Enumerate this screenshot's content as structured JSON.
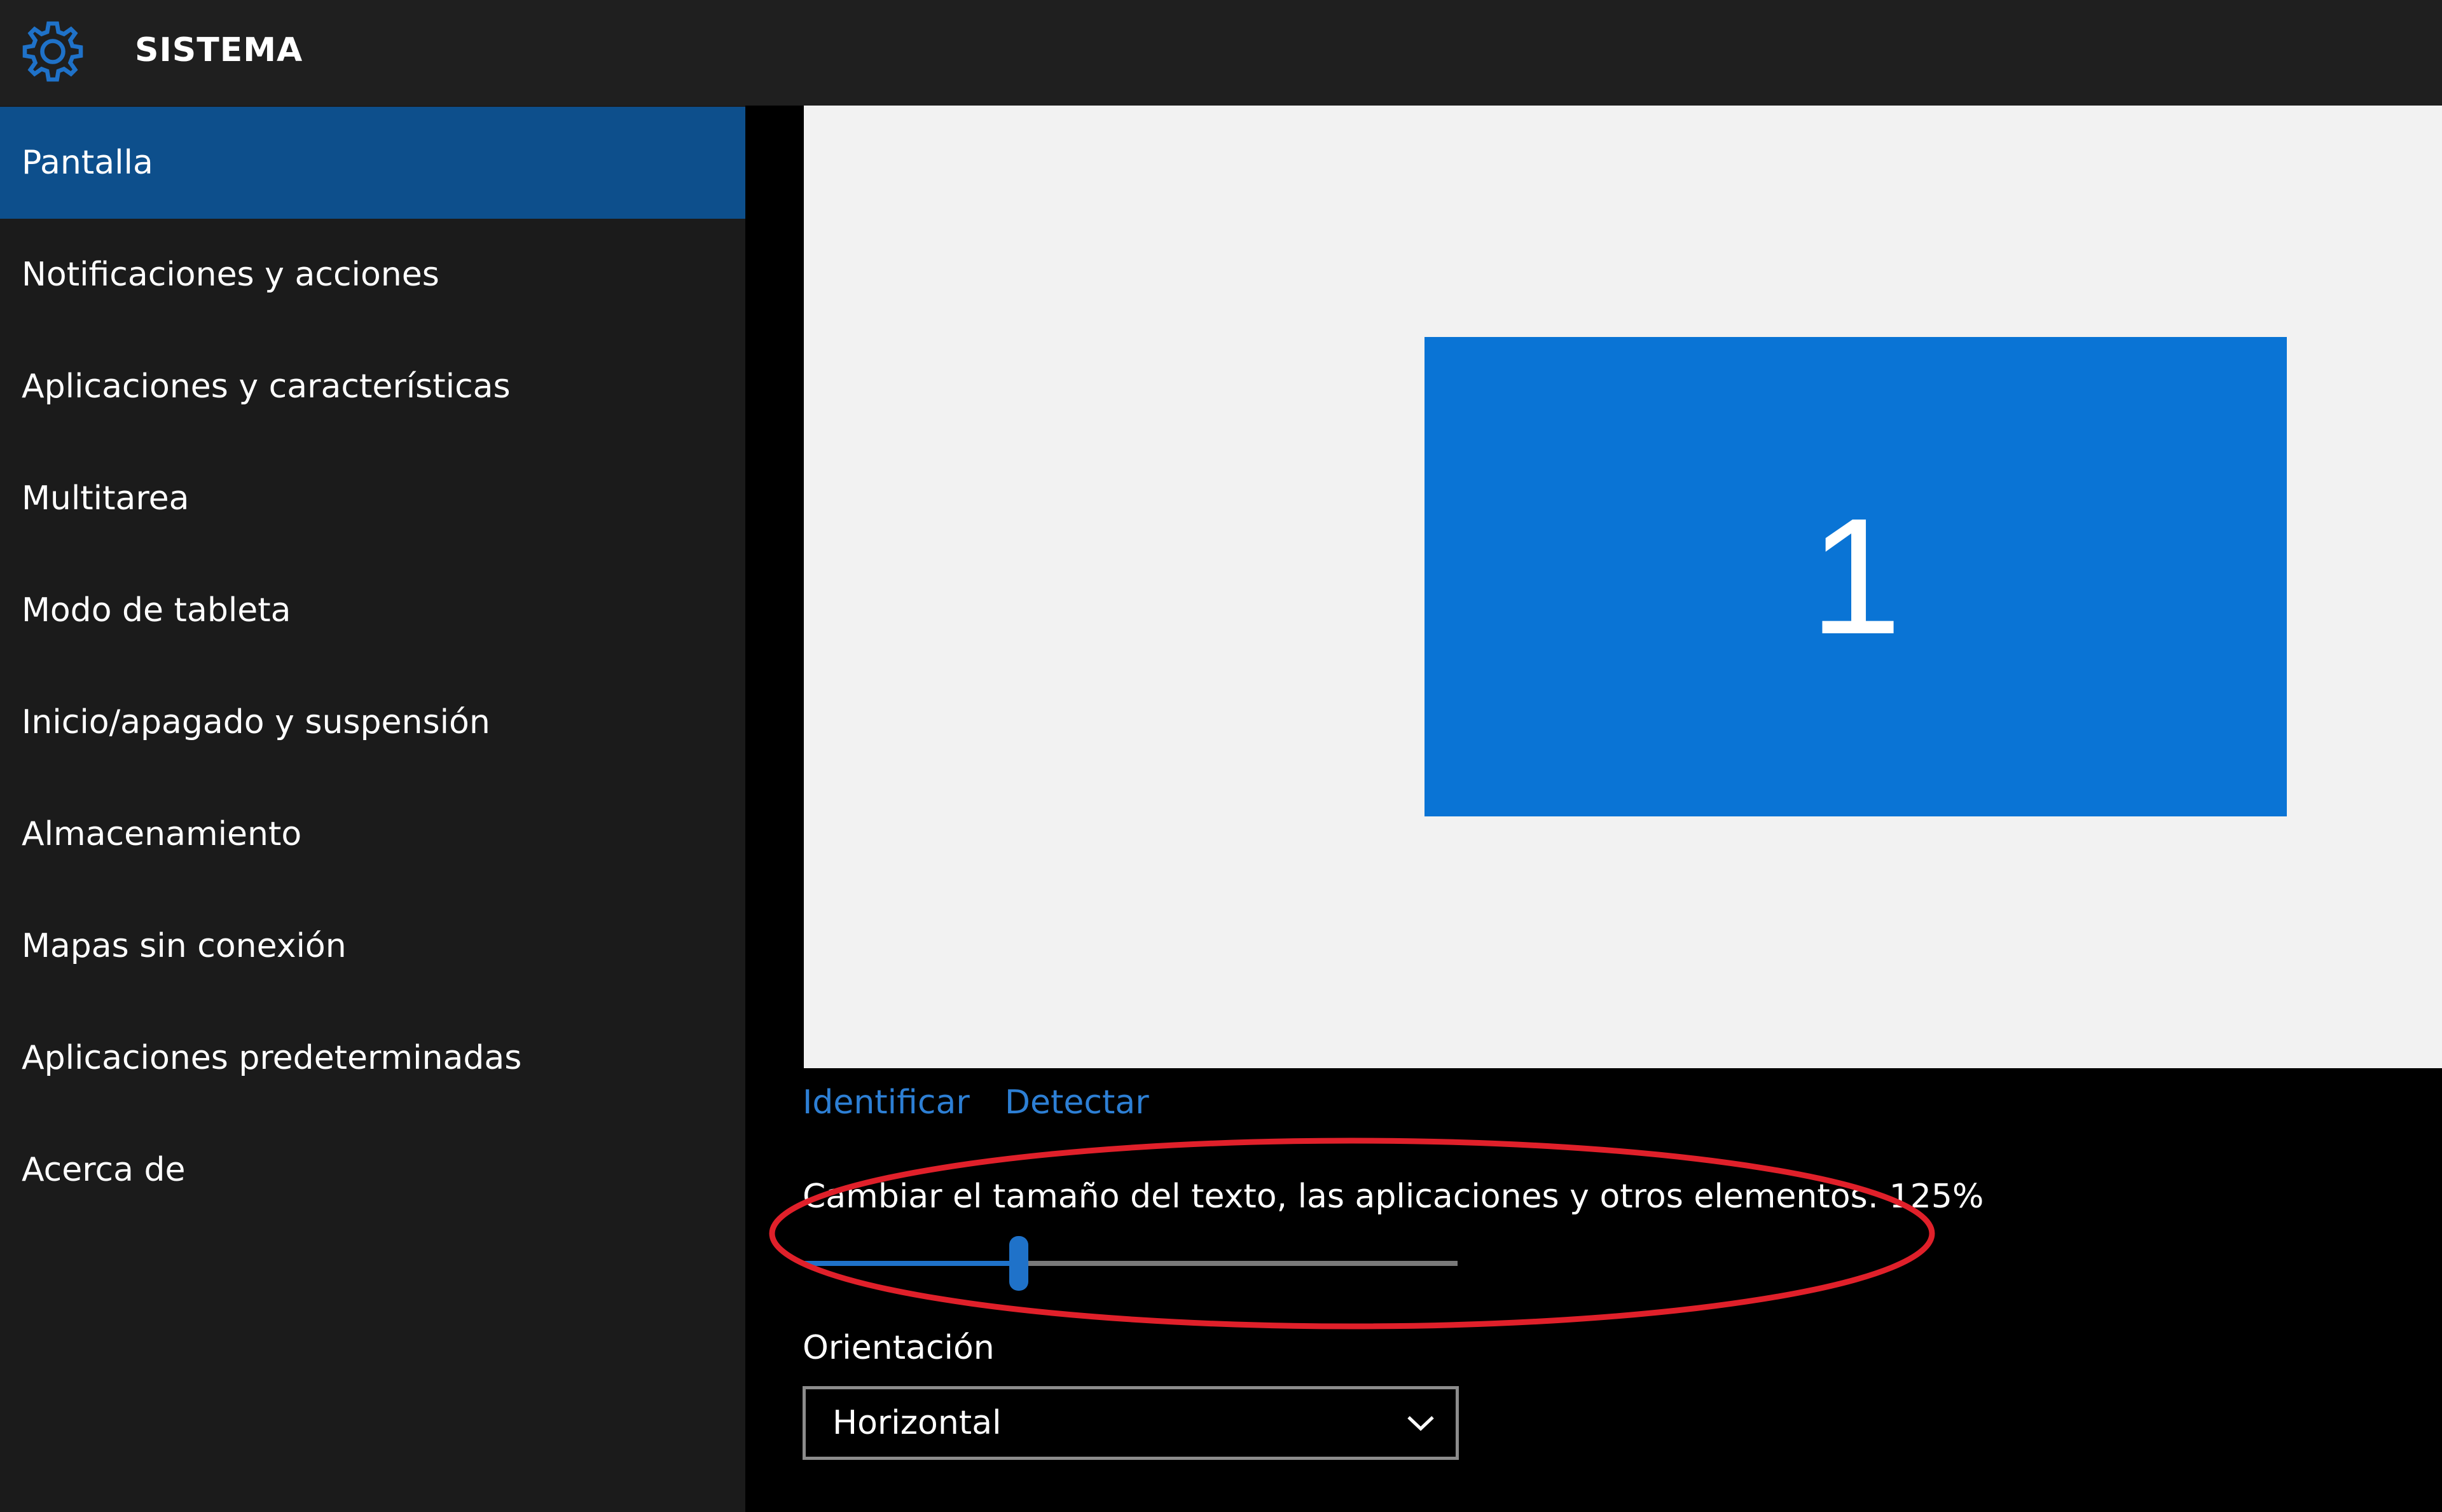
{
  "titlebar": {
    "icon": "gear-icon",
    "title": "SISTEMA"
  },
  "sidebar": {
    "items": [
      {
        "label": "Pantalla",
        "selected": true
      },
      {
        "label": "Notificaciones y acciones",
        "selected": false
      },
      {
        "label": "Aplicaciones y características",
        "selected": false
      },
      {
        "label": "Multitarea",
        "selected": false
      },
      {
        "label": "Modo de tableta",
        "selected": false
      },
      {
        "label": "Inicio/apagado y suspensión",
        "selected": false
      },
      {
        "label": "Almacenamiento",
        "selected": false
      },
      {
        "label": "Mapas sin conexión",
        "selected": false
      },
      {
        "label": "Aplicaciones predeterminadas",
        "selected": false
      },
      {
        "label": "Acerca de",
        "selected": false
      }
    ]
  },
  "display": {
    "monitor_number": "1",
    "identify_link": "Identificar",
    "detect_link": "Detectar"
  },
  "scale": {
    "label": "Cambiar el tamaño del texto, las aplicaciones y otros elementos: 125%",
    "slider_fraction": 0.33
  },
  "orientation": {
    "label": "Orientación",
    "value": "Horizontal"
  },
  "colors": {
    "accent": "#0a74d5",
    "selected_nav": "#0d4f8c",
    "link": "#2d7fd4",
    "highlight_annotation": "#e0202a"
  }
}
